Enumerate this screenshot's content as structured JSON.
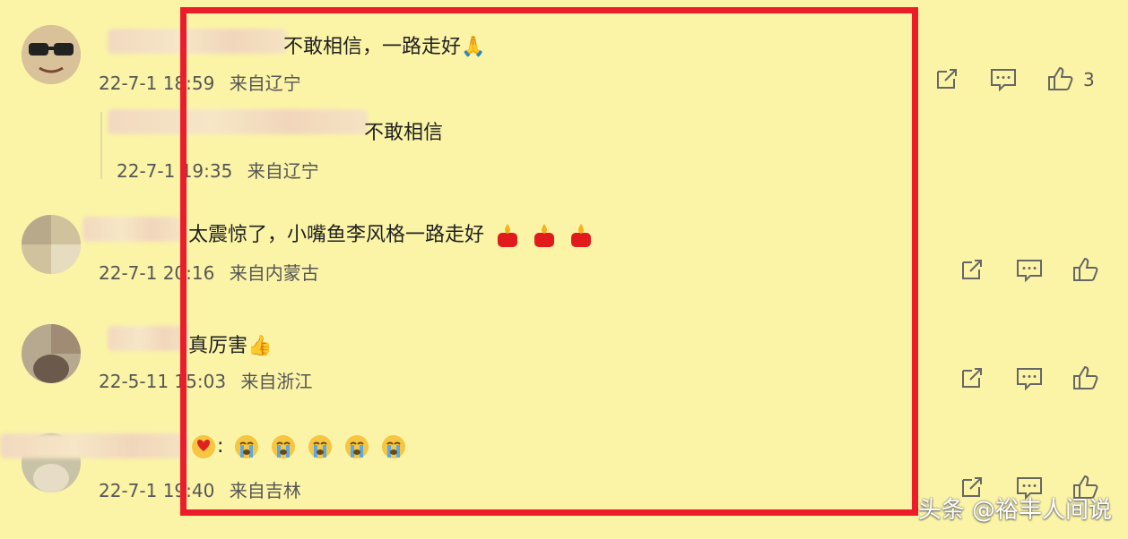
{
  "comments": [
    {
      "text": "不敢相信，一路走好",
      "emoji": "🙏",
      "date": "22-7-1",
      "time": "18:59",
      "location": "来自辽宁",
      "likes": "3",
      "reply": {
        "text": "不敢相信",
        "date": "22-7-1",
        "time": "19:35",
        "location": "来自辽宁"
      }
    },
    {
      "text": "太震惊了，小嘴鱼李风格一路走好",
      "date": "22-7-1",
      "time": "20:16",
      "location": "来自内蒙古"
    },
    {
      "text": "真厉害",
      "emoji": "👍",
      "date": "22-5-11",
      "time": "15:03",
      "location": "来自浙江"
    },
    {
      "text": ":",
      "date": "22-7-1",
      "time": "19:40",
      "location": "来自吉林"
    }
  ],
  "icons": [
    "share-icon",
    "comment-icon",
    "like-icon",
    "candle-emoji",
    "crying-emoji"
  ],
  "highlight_color": "#ec1c2a",
  "watermark": "头条 @裕丰人间说"
}
